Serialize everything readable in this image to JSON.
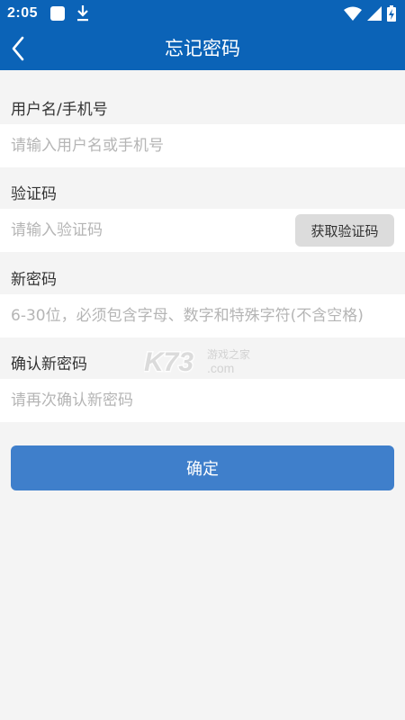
{
  "status_bar": {
    "time": "2:05",
    "icons": [
      "notification-square-icon",
      "download-icon",
      "wifi-icon",
      "signal-icon",
      "battery-charging-icon"
    ]
  },
  "header": {
    "title": "忘记密码",
    "back_icon": "back-arrow-icon",
    "color": "#0b63b7"
  },
  "form": {
    "username_label": "用户名/手机号",
    "username_placeholder": "请输入用户名或手机号",
    "code_label": "验证码",
    "code_placeholder": "请输入验证码",
    "get_code_label": "获取验证码",
    "new_password_label": "新密码",
    "new_password_placeholder": "6-30位，必须包含字母、数字和特殊字符(不含空格)",
    "confirm_label": "确认新密码",
    "confirm_placeholder": "请再次确认新密码",
    "submit_label": "确定",
    "submit_color": "#3f7fcb"
  },
  "watermark": {
    "brand": "K73",
    "tagline": "游戏之家",
    "domain": ".com"
  }
}
